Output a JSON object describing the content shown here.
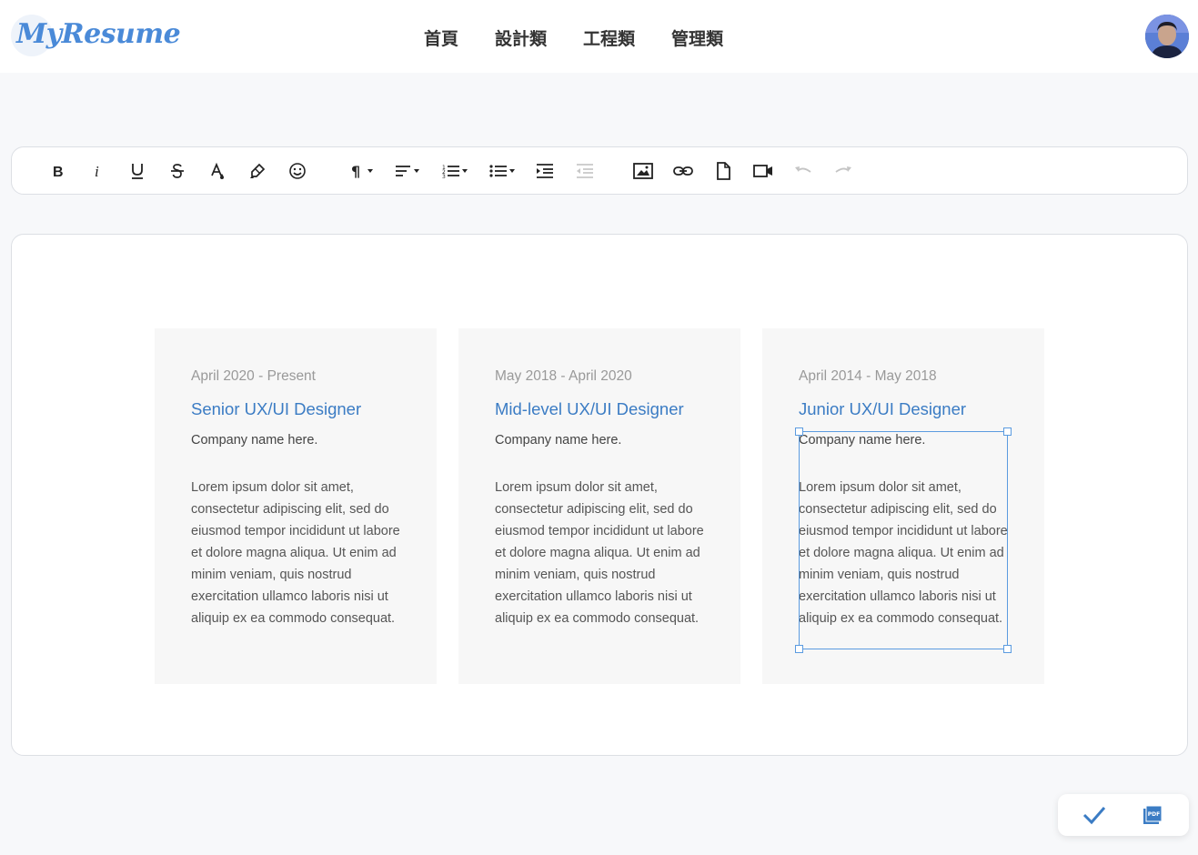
{
  "app": {
    "logo_text": "MyResume"
  },
  "nav": {
    "items": [
      {
        "label": "首頁"
      },
      {
        "label": "設計類"
      },
      {
        "label": "工程類"
      },
      {
        "label": "管理類"
      }
    ]
  },
  "toolbar": {
    "buttons": [
      {
        "icon": "bold-icon",
        "glyph": "B"
      },
      {
        "icon": "italic-icon",
        "glyph": "i"
      },
      {
        "icon": "underline-icon",
        "glyph": "U"
      },
      {
        "icon": "strikethrough-icon",
        "glyph": "S"
      },
      {
        "icon": "font-color-icon"
      },
      {
        "icon": "highlight-icon"
      },
      {
        "icon": "emoji-icon"
      },
      {
        "icon": "paragraph-format-icon",
        "glyph": "¶"
      },
      {
        "icon": "align-icon"
      },
      {
        "icon": "ordered-list-icon"
      },
      {
        "icon": "unordered-list-icon"
      },
      {
        "icon": "indent-icon"
      },
      {
        "icon": "outdent-icon",
        "disabled": true
      },
      {
        "icon": "insert-image-icon"
      },
      {
        "icon": "insert-link-icon"
      },
      {
        "icon": "insert-file-icon"
      },
      {
        "icon": "insert-video-icon"
      },
      {
        "icon": "undo-icon",
        "disabled": true
      },
      {
        "icon": "redo-icon",
        "disabled": true
      }
    ]
  },
  "cards": [
    {
      "date": "April 2020 - Present",
      "title": "Senior UX/UI Designer",
      "company": "Company name here.",
      "body": "Lorem ipsum dolor sit amet, consectetur adipiscing elit, sed do eiusmod tempor incididunt ut labore et dolore magna aliqua. Ut enim ad minim veniam, quis nostrud exercitation ullamco laboris nisi ut aliquip ex ea commodo consequat."
    },
    {
      "date": "May 2018 - April 2020",
      "title": "Mid-level UX/UI Designer",
      "company": "Company name here.",
      "body": "Lorem ipsum dolor sit amet, consectetur adipiscing elit, sed do eiusmod tempor incididunt ut labore et dolore magna aliqua. Ut enim ad minim veniam, quis nostrud exercitation ullamco laboris nisi ut aliquip ex ea commodo consequat."
    },
    {
      "date": "April 2014 - May 2018",
      "title": "Junior UX/UI Designer",
      "company": "Company name here.",
      "body": "Lorem ipsum dolor sit amet, consectetur adipiscing elit, sed do eiusmod tempor incididunt ut labore et dolore magna aliqua. Ut enim ad minim veniam, quis nostrud exercitation ullamco laboris nisi ut aliquip ex ea commodo consequat."
    }
  ],
  "actions": {
    "confirm_icon": "check-icon",
    "pdf_icon": "pdf-icon",
    "pdf_label": "PDF"
  },
  "colors": {
    "accent": "#3b7cc4",
    "logo": "#4a8ad8",
    "selection": "#5b9be0"
  }
}
